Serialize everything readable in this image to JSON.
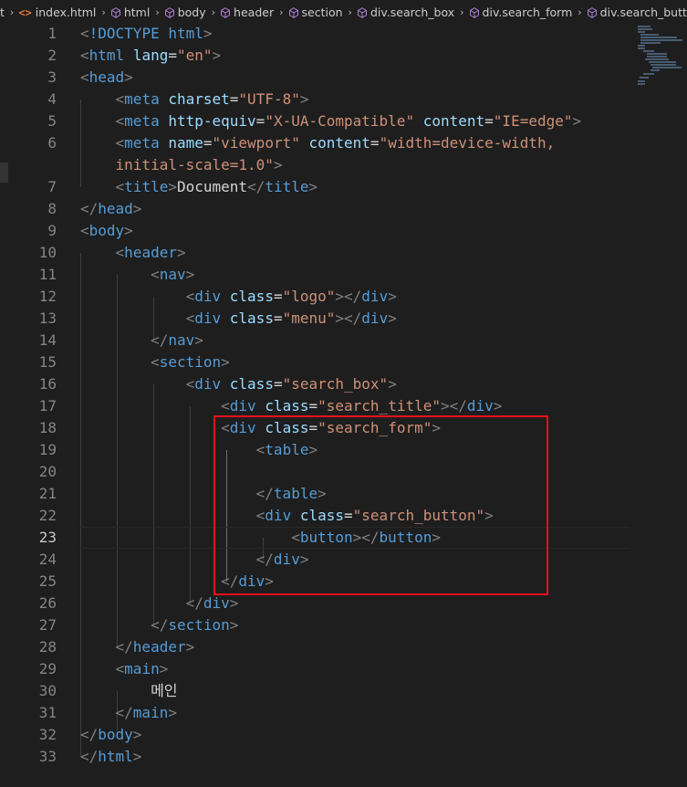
{
  "breadcrumb": {
    "items": [
      {
        "label": "t",
        "icon": "none"
      },
      {
        "label": "index.html",
        "icon": "html-file-icon"
      },
      {
        "label": "html",
        "icon": "cube-icon"
      },
      {
        "label": "body",
        "icon": "cube-icon"
      },
      {
        "label": "header",
        "icon": "cube-icon"
      },
      {
        "label": "section",
        "icon": "cube-icon"
      },
      {
        "label": "div.search_box",
        "icon": "cube-icon"
      },
      {
        "label": "div.search_form",
        "icon": "cube-icon"
      },
      {
        "label": "div.search_butt",
        "icon": "cube-icon"
      }
    ]
  },
  "editor": {
    "active_line": "23",
    "lines": [
      {
        "n": "1",
        "tokens": [
          [
            "br",
            "<"
          ],
          [
            "doctype",
            "!DOCTYPE"
          ],
          [
            "txt",
            " "
          ],
          [
            "tag",
            "html"
          ],
          [
            "br",
            ">"
          ]
        ]
      },
      {
        "n": "2",
        "tokens": [
          [
            "br",
            "<"
          ],
          [
            "tag",
            "html"
          ],
          [
            "txt",
            " "
          ],
          [
            "attr",
            "lang"
          ],
          [
            "txt",
            "="
          ],
          [
            "str",
            "\"en\""
          ],
          [
            "br",
            ">"
          ]
        ]
      },
      {
        "n": "3",
        "tokens": [
          [
            "br",
            "<"
          ],
          [
            "tag",
            "head"
          ],
          [
            "br",
            ">"
          ]
        ]
      },
      {
        "n": "4",
        "tokens": [
          [
            "txt",
            "    "
          ],
          [
            "br",
            "<"
          ],
          [
            "tag",
            "meta"
          ],
          [
            "txt",
            " "
          ],
          [
            "attr",
            "charset"
          ],
          [
            "txt",
            "="
          ],
          [
            "str",
            "\"UTF-8\""
          ],
          [
            "br",
            ">"
          ]
        ]
      },
      {
        "n": "5",
        "tokens": [
          [
            "txt",
            "    "
          ],
          [
            "br",
            "<"
          ],
          [
            "tag",
            "meta"
          ],
          [
            "txt",
            " "
          ],
          [
            "attr",
            "http-equiv"
          ],
          [
            "txt",
            "="
          ],
          [
            "str",
            "\"X-UA-Compatible\""
          ],
          [
            "txt",
            " "
          ],
          [
            "attr",
            "content"
          ],
          [
            "txt",
            "="
          ],
          [
            "str",
            "\"IE=edge\""
          ],
          [
            "br",
            ">"
          ]
        ]
      },
      {
        "n": "6",
        "tokens": [
          [
            "txt",
            "    "
          ],
          [
            "br",
            "<"
          ],
          [
            "tag",
            "meta"
          ],
          [
            "txt",
            " "
          ],
          [
            "attr",
            "name"
          ],
          [
            "txt",
            "="
          ],
          [
            "str",
            "\"viewport\""
          ],
          [
            "txt",
            " "
          ],
          [
            "attr",
            "content"
          ],
          [
            "txt",
            "="
          ],
          [
            "str",
            "\"width=device-width,"
          ]
        ]
      },
      {
        "n": "",
        "tokens": [
          [
            "txt",
            "    "
          ],
          [
            "str",
            "initial-scale=1.0\""
          ],
          [
            "br",
            ">"
          ]
        ]
      },
      {
        "n": "7",
        "tokens": [
          [
            "txt",
            "    "
          ],
          [
            "br",
            "<"
          ],
          [
            "tag",
            "title"
          ],
          [
            "br",
            ">"
          ],
          [
            "txt",
            "Document"
          ],
          [
            "br",
            "</"
          ],
          [
            "tag",
            "title"
          ],
          [
            "br",
            ">"
          ]
        ]
      },
      {
        "n": "8",
        "tokens": [
          [
            "br",
            "</"
          ],
          [
            "tag",
            "head"
          ],
          [
            "br",
            ">"
          ]
        ]
      },
      {
        "n": "9",
        "tokens": [
          [
            "br",
            "<"
          ],
          [
            "tag",
            "body"
          ],
          [
            "br",
            ">"
          ]
        ]
      },
      {
        "n": "10",
        "tokens": [
          [
            "txt",
            "    "
          ],
          [
            "br",
            "<"
          ],
          [
            "tag",
            "header"
          ],
          [
            "br",
            ">"
          ]
        ]
      },
      {
        "n": "11",
        "tokens": [
          [
            "txt",
            "        "
          ],
          [
            "br",
            "<"
          ],
          [
            "tag",
            "nav"
          ],
          [
            "br",
            ">"
          ]
        ]
      },
      {
        "n": "12",
        "tokens": [
          [
            "txt",
            "            "
          ],
          [
            "br",
            "<"
          ],
          [
            "tag",
            "div"
          ],
          [
            "txt",
            " "
          ],
          [
            "attr",
            "class"
          ],
          [
            "txt",
            "="
          ],
          [
            "str",
            "\"logo\""
          ],
          [
            "br",
            "></"
          ],
          [
            "tag",
            "div"
          ],
          [
            "br",
            ">"
          ]
        ]
      },
      {
        "n": "13",
        "tokens": [
          [
            "txt",
            "            "
          ],
          [
            "br",
            "<"
          ],
          [
            "tag",
            "div"
          ],
          [
            "txt",
            " "
          ],
          [
            "attr",
            "class"
          ],
          [
            "txt",
            "="
          ],
          [
            "str",
            "\"menu\""
          ],
          [
            "br",
            "></"
          ],
          [
            "tag",
            "div"
          ],
          [
            "br",
            ">"
          ]
        ]
      },
      {
        "n": "14",
        "tokens": [
          [
            "txt",
            "        "
          ],
          [
            "br",
            "</"
          ],
          [
            "tag",
            "nav"
          ],
          [
            "br",
            ">"
          ]
        ]
      },
      {
        "n": "15",
        "tokens": [
          [
            "txt",
            "        "
          ],
          [
            "br",
            "<"
          ],
          [
            "tag",
            "section"
          ],
          [
            "br",
            ">"
          ]
        ]
      },
      {
        "n": "16",
        "tokens": [
          [
            "txt",
            "            "
          ],
          [
            "br",
            "<"
          ],
          [
            "tag",
            "div"
          ],
          [
            "txt",
            " "
          ],
          [
            "attr",
            "class"
          ],
          [
            "txt",
            "="
          ],
          [
            "str",
            "\"search_box\""
          ],
          [
            "br",
            ">"
          ]
        ]
      },
      {
        "n": "17",
        "tokens": [
          [
            "txt",
            "                "
          ],
          [
            "br",
            "<"
          ],
          [
            "tag",
            "div"
          ],
          [
            "txt",
            " "
          ],
          [
            "attr",
            "class"
          ],
          [
            "txt",
            "="
          ],
          [
            "str",
            "\"search_title\""
          ],
          [
            "br",
            "></"
          ],
          [
            "tag",
            "div"
          ],
          [
            "br",
            ">"
          ]
        ]
      },
      {
        "n": "18",
        "tokens": [
          [
            "txt",
            "                "
          ],
          [
            "br",
            "<"
          ],
          [
            "tag",
            "div"
          ],
          [
            "txt",
            " "
          ],
          [
            "attr",
            "class"
          ],
          [
            "txt",
            "="
          ],
          [
            "str",
            "\"search_form\""
          ],
          [
            "br",
            ">"
          ]
        ]
      },
      {
        "n": "19",
        "tokens": [
          [
            "txt",
            "                    "
          ],
          [
            "br",
            "<"
          ],
          [
            "tag",
            "table"
          ],
          [
            "br",
            ">"
          ]
        ]
      },
      {
        "n": "20",
        "tokens": []
      },
      {
        "n": "21",
        "tokens": [
          [
            "txt",
            "                    "
          ],
          [
            "br",
            "</"
          ],
          [
            "tag",
            "table"
          ],
          [
            "br",
            ">"
          ]
        ]
      },
      {
        "n": "22",
        "tokens": [
          [
            "txt",
            "                    "
          ],
          [
            "br",
            "<"
          ],
          [
            "tag",
            "div"
          ],
          [
            "txt",
            " "
          ],
          [
            "attr",
            "class"
          ],
          [
            "txt",
            "="
          ],
          [
            "str",
            "\"search_button\""
          ],
          [
            "br",
            ">"
          ]
        ]
      },
      {
        "n": "23",
        "tokens": [
          [
            "txt",
            "                        "
          ],
          [
            "br",
            "<"
          ],
          [
            "tag",
            "button"
          ],
          [
            "br",
            "></"
          ],
          [
            "tag",
            "button"
          ],
          [
            "br",
            ">"
          ]
        ]
      },
      {
        "n": "24",
        "tokens": [
          [
            "txt",
            "                    "
          ],
          [
            "br",
            "</"
          ],
          [
            "tag",
            "div"
          ],
          [
            "br",
            ">"
          ]
        ]
      },
      {
        "n": "25",
        "tokens": [
          [
            "txt",
            "                "
          ],
          [
            "br",
            "</"
          ],
          [
            "tag",
            "div"
          ],
          [
            "br",
            ">"
          ]
        ]
      },
      {
        "n": "26",
        "tokens": [
          [
            "txt",
            "            "
          ],
          [
            "br",
            "</"
          ],
          [
            "tag",
            "div"
          ],
          [
            "br",
            ">"
          ]
        ]
      },
      {
        "n": "27",
        "tokens": [
          [
            "txt",
            "        "
          ],
          [
            "br",
            "</"
          ],
          [
            "tag",
            "section"
          ],
          [
            "br",
            ">"
          ]
        ]
      },
      {
        "n": "28",
        "tokens": [
          [
            "txt",
            "    "
          ],
          [
            "br",
            "</"
          ],
          [
            "tag",
            "header"
          ],
          [
            "br",
            ">"
          ]
        ]
      },
      {
        "n": "29",
        "tokens": [
          [
            "txt",
            "    "
          ],
          [
            "br",
            "<"
          ],
          [
            "tag",
            "main"
          ],
          [
            "br",
            ">"
          ]
        ]
      },
      {
        "n": "30",
        "tokens": [
          [
            "txt",
            "        메인"
          ]
        ]
      },
      {
        "n": "31",
        "tokens": [
          [
            "txt",
            "    "
          ],
          [
            "br",
            "</"
          ],
          [
            "tag",
            "main"
          ],
          [
            "br",
            ">"
          ]
        ]
      },
      {
        "n": "32",
        "tokens": [
          [
            "br",
            "</"
          ],
          [
            "tag",
            "body"
          ],
          [
            "br",
            ">"
          ]
        ]
      },
      {
        "n": "33",
        "tokens": [
          [
            "br",
            "</"
          ],
          [
            "tag",
            "html"
          ],
          [
            "br",
            ">"
          ]
        ]
      }
    ]
  },
  "colors": {
    "background": "#1e1e1e",
    "tag": "#569cd6",
    "attribute": "#9cdcfe",
    "string": "#ce9178",
    "bracket": "#808080",
    "highlight_box": "#e8101a"
  }
}
